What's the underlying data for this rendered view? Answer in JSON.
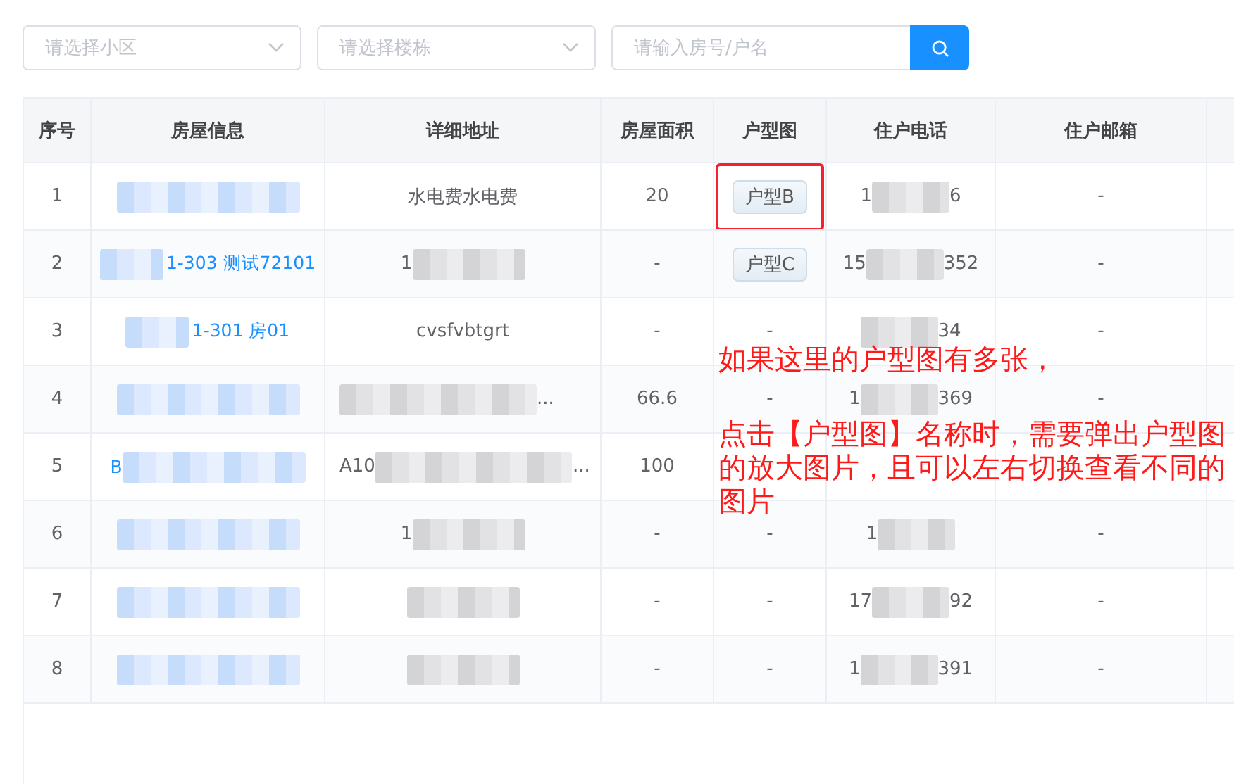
{
  "filters": {
    "community_select": {
      "placeholder": "请选择小区"
    },
    "building_select": {
      "placeholder": "请选择楼栋"
    },
    "search": {
      "placeholder": "请输入房号/户名"
    }
  },
  "table": {
    "columns": [
      "序号",
      "房屋信息",
      "详细地址",
      "房屋面积",
      "户型图",
      "住户电话",
      "住户邮箱"
    ],
    "rows": [
      {
        "index": "1",
        "house": {
          "blurred": true
        },
        "address": {
          "before": "水电费水电费"
        },
        "area": "20",
        "plan": {
          "kind": "tag",
          "text": "户型B",
          "highlighted": true
        },
        "phone": {
          "before": "1",
          "blurred": true,
          "after": "6"
        },
        "email": "-"
      },
      {
        "index": "2",
        "house": {
          "blurred": true,
          "after": "1-303 测试72101"
        },
        "address": {
          "before": "1",
          "blurred": true
        },
        "area": "-",
        "plan": {
          "kind": "tag",
          "text": "户型C",
          "highlighted": false
        },
        "phone": {
          "before": "15",
          "blurred": true,
          "after": "352"
        },
        "email": "-"
      },
      {
        "index": "3",
        "house": {
          "blurred": true,
          "after": "1-301 房01"
        },
        "address": {
          "before": "cvsfvbtgrt"
        },
        "area": "-",
        "plan": {
          "kind": "text",
          "text": "-"
        },
        "phone": {
          "blurred": true,
          "after": "34"
        },
        "email": "-"
      },
      {
        "index": "4",
        "house": {
          "blurred": true
        },
        "address": {
          "blurred": true,
          "after": "..."
        },
        "area": "66.6",
        "plan": {
          "kind": "text",
          "text": "-"
        },
        "phone": {
          "before": "1",
          "blurred": true,
          "after": "369"
        },
        "email": "-"
      },
      {
        "index": "5",
        "house": {
          "before": "B",
          "blurred": true
        },
        "address": {
          "before": "A10",
          "blurred": true,
          "after": "..."
        },
        "area": "100",
        "phone": {}
      },
      {
        "index": "6",
        "house": {
          "blurred": true
        },
        "address": {
          "before": "1",
          "blurred": true
        },
        "area": "-",
        "plan": {
          "kind": "text",
          "text": "-"
        },
        "phone": {
          "before": "1",
          "blurred": true
        },
        "email": "-"
      },
      {
        "index": "7",
        "house": {
          "blurred": true
        },
        "address": {
          "blurred": true
        },
        "area": "-",
        "plan": {
          "kind": "text",
          "text": "-"
        },
        "phone": {
          "before": "17",
          "blurred": true,
          "after": "92"
        },
        "email": "-"
      },
      {
        "index": "8",
        "house": {
          "blurred": true
        },
        "address": {
          "blurred": true
        },
        "area": "-",
        "plan": {
          "kind": "text",
          "text": "-"
        },
        "phone": {
          "before": "1",
          "blurred": true,
          "after": "391"
        },
        "email": "-"
      }
    ]
  },
  "annotation": {
    "paragraphs": [
      "如果这里的户型图有多张，",
      "点击【户型图】名称时，需要弹出户型图的放大图片，且可以左右切换查看不同的图片"
    ]
  }
}
